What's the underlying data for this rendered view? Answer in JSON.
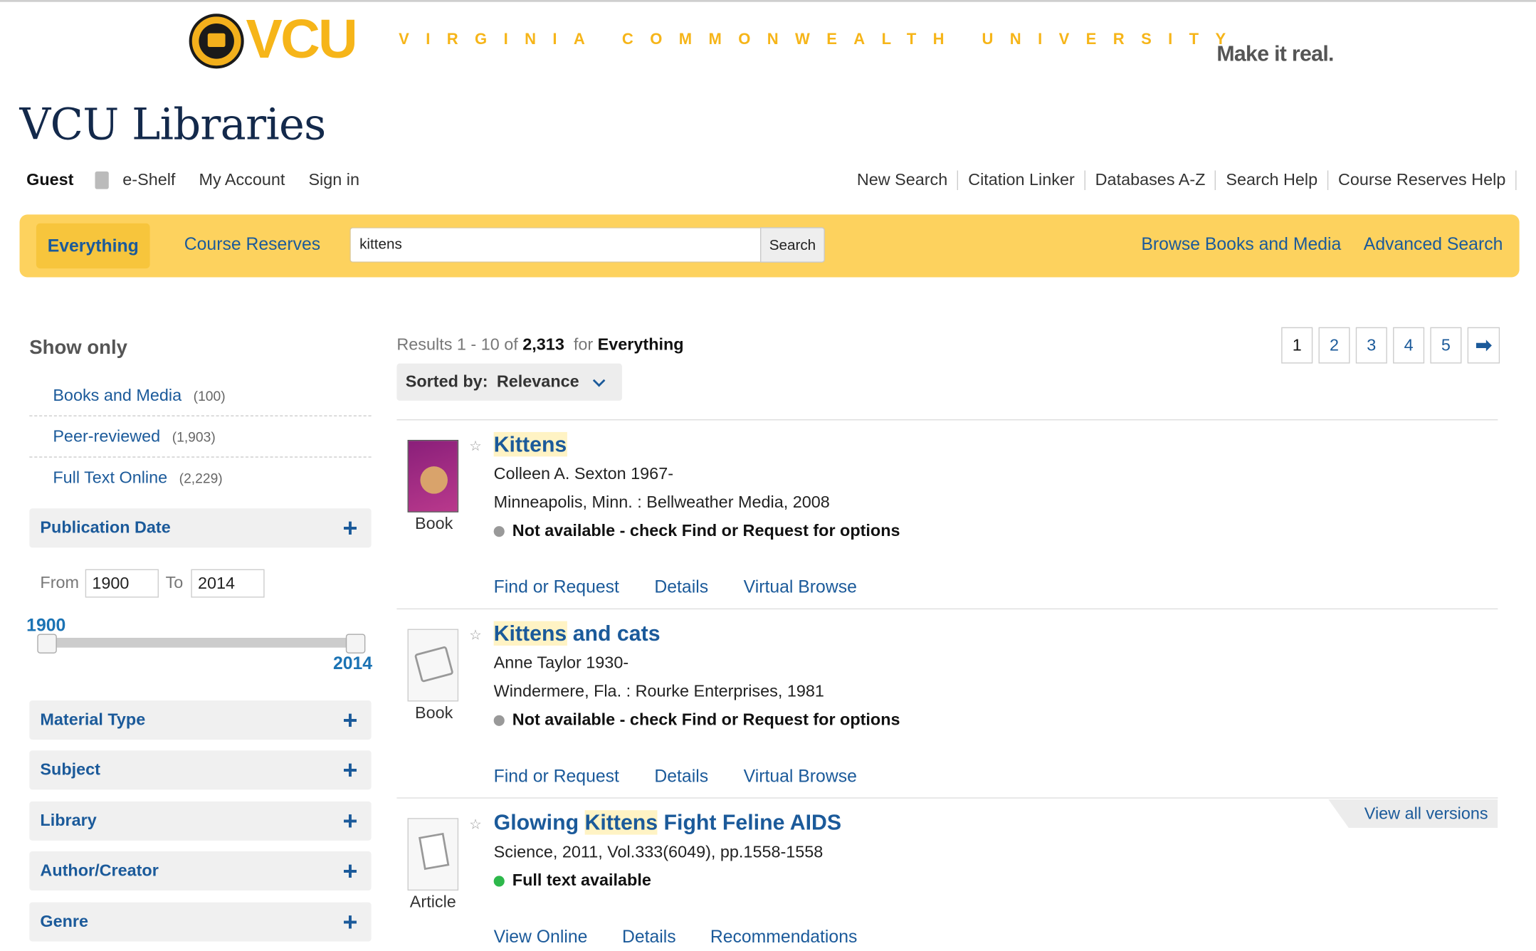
{
  "header": {
    "logo_text": "VCU",
    "university": "VIRGINIA COMMONWEALTH UNIVERSITY",
    "tagline": "Make it real.",
    "site_title": "VCU Libraries"
  },
  "userbar": {
    "guest": "Guest",
    "eshelf": "e-Shelf",
    "account": "My Account",
    "signin": "Sign in"
  },
  "toplinks": [
    "New Search",
    "Citation Linker",
    "Databases A-Z",
    "Search Help",
    "Course Reserves Help"
  ],
  "search": {
    "tab_everything": "Everything",
    "tab_course": "Course Reserves",
    "query": "kittens",
    "button": "Search",
    "browse": "Browse Books and Media",
    "advanced": "Advanced Search"
  },
  "sidebar": {
    "show_only": "Show only",
    "facets": [
      {
        "label": "Books and Media",
        "count": "(100)"
      },
      {
        "label": "Peer-reviewed",
        "count": "(1,903)"
      },
      {
        "label": "Full Text Online",
        "count": "(2,229)"
      }
    ],
    "publication_date": "Publication Date",
    "from_label": "From",
    "to_label": "To",
    "from_value": "1900",
    "to_value": "2014",
    "slider_min": "1900",
    "slider_max": "2014",
    "sections": [
      "Material Type",
      "Subject",
      "Library",
      "Author/Creator",
      "Genre"
    ]
  },
  "results": {
    "prefix": "Results 1 - 10 of",
    "total": "2,313",
    "for_label": "for",
    "scope": "Everything",
    "sort_label": "Sorted by:",
    "sort_value": "Relevance",
    "pages": [
      "1",
      "2",
      "3",
      "4",
      "5"
    ],
    "next": "➡",
    "records": [
      {
        "type": "Book",
        "title_hl": "Kittens",
        "title_rest": "",
        "line1": "Colleen A. Sexton 1967-",
        "line2": "Minneapolis, Minn. : Bellweather Media, 2008",
        "availability": "Not available - check Find or Request for options",
        "actions": [
          "Find or Request",
          "Details",
          "Virtual Browse"
        ]
      },
      {
        "type": "Book",
        "title_hl": "Kittens",
        "title_rest": " and cats",
        "line1": "Anne Taylor 1930-",
        "line2": "Windermere, Fla. : Rourke Enterprises, 1981",
        "availability": "Not available - check Find or Request for options",
        "actions": [
          "Find or Request",
          "Details",
          "Virtual Browse"
        ]
      },
      {
        "type": "Article",
        "title_pre": "Glowing ",
        "title_hl": "Kittens",
        "title_rest": " Fight Feline AIDS",
        "line1": "Science, 2011, Vol.333(6049), pp.1558-1558",
        "availability": "Full text available",
        "actions": [
          "View Online",
          "Details",
          "Recommendations"
        ],
        "versions": "View all versions"
      }
    ]
  }
}
